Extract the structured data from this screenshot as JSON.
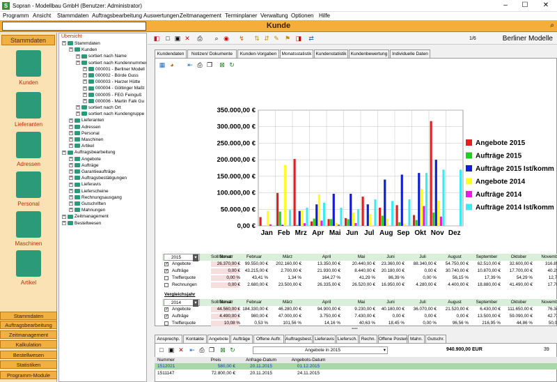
{
  "window": {
    "title": "Sopran - Modellbau GmbH (Benutzer: Administrator)",
    "app_icon": "S"
  },
  "menu": [
    "Programm",
    "Ansicht",
    "Stammdaten",
    "Auftragsbearbeitung",
    "Auswertungen",
    "Zeitmanagement",
    "Terminplaner",
    "Verwaltung",
    "Optionen",
    "Hilfe"
  ],
  "module_title": "Kunde",
  "left_nav": {
    "header": "Stammdaten",
    "items": [
      "Kunden",
      "Lieferanten",
      "Adressen",
      "Personal",
      "Maschinen",
      "Artikel"
    ],
    "modules": [
      "Stammdaten",
      "Auftragsbearbeitung",
      "Zeitmanagement",
      "Kalkulation",
      "Bestellwesen",
      "Statistiken",
      "Programm-Module"
    ]
  },
  "tree": {
    "header": "Übersicht",
    "rows": [
      {
        "text": "Stammdaten",
        "lvl": 0
      },
      {
        "text": "Kunden",
        "lvl": 1
      },
      {
        "text": "sortiert nach Name",
        "lvl": 2
      },
      {
        "text": "sortiert nach Kundennummer",
        "lvl": 2
      },
      {
        "text": "000001 - Berliner Modell",
        "lvl": 3
      },
      {
        "text": "000002 - Börde Guss",
        "lvl": 3
      },
      {
        "text": "000003 - Harzer Hütte",
        "lvl": 3
      },
      {
        "text": "000004 - Göltinger Maßt",
        "lvl": 3
      },
      {
        "text": "000005 - FEG Feinguß",
        "lvl": 3
      },
      {
        "text": "000006 - Martin Falk Gu",
        "lvl": 3
      },
      {
        "text": "sortiert nach Ort",
        "lvl": 2
      },
      {
        "text": "sortiert nach Kundengruppe",
        "lvl": 2
      },
      {
        "text": "Lieferanten",
        "lvl": 1
      },
      {
        "text": "Adressen",
        "lvl": 1
      },
      {
        "text": "Personal",
        "lvl": 1
      },
      {
        "text": "Maschinen",
        "lvl": 1
      },
      {
        "text": "Artikel",
        "lvl": 1
      },
      {
        "text": "Auftragsbearbeitung",
        "lvl": 0
      },
      {
        "text": "Angebote",
        "lvl": 1
      },
      {
        "text": "Aufträge",
        "lvl": 1
      },
      {
        "text": "Garantieaufträge",
        "lvl": 1
      },
      {
        "text": "Auftragsbestätigungen",
        "lvl": 1
      },
      {
        "text": "Lieferavis",
        "lvl": 1
      },
      {
        "text": "Lieferscheine",
        "lvl": 1
      },
      {
        "text": "Rechnungsausgang",
        "lvl": 1
      },
      {
        "text": "Gutschriften",
        "lvl": 1
      },
      {
        "text": "Mahnungen",
        "lvl": 1
      },
      {
        "text": "Zeitmanagement",
        "lvl": 0
      },
      {
        "text": "Bestellwesen",
        "lvl": 0
      }
    ]
  },
  "toolbar": {
    "record": "1/6",
    "customer_name": "Berliner Modelle"
  },
  "tabs_top": [
    "Kundendaten",
    "Notizen/ Dokumente",
    "Kunden-Vorgaben",
    "Monatsstatistik",
    "Kundenstatistik",
    "Kundenbewertung",
    "Individuelle Daten"
  ],
  "tabs_top_active": "Monatsstatistik",
  "colors": {
    "Angebote 2015": "#e02020",
    "Aufträge 2015": "#20d020",
    "Aufträge 2015 Ist/komm": "#1020d0",
    "Angebote 2014": "#ffff20",
    "Aufträge 2014": "#e020e0",
    "Aufträge 2014 Ist/komm": "#40e8f0"
  },
  "chart_data": {
    "type": "bar",
    "categories": [
      "Jan",
      "Feb",
      "Mrz",
      "Apr",
      "Mai",
      "Jun",
      "Jul",
      "Aug",
      "Sep",
      "Okt",
      "Nov",
      "Dez"
    ],
    "ylim": [
      0,
      350000
    ],
    "yticks": [
      "0,00 €",
      "50.000,00 €",
      "100.000,00 €",
      "150.000,00 €",
      "200.000,00 €",
      "250.000,00 €",
      "300.000,00 €",
      "350.000,00 €"
    ],
    "ytick_values": [
      0,
      50000,
      100000,
      150000,
      200000,
      250000,
      300000,
      350000
    ],
    "series": [
      {
        "name": "Angebote 2015",
        "values": [
          26370,
          99550,
          202160,
          13350,
          20440,
          23360,
          88340,
          54750,
          62510,
          32600,
          316890,
          0
        ]
      },
      {
        "name": "Aufträge 2015",
        "values": [
          0,
          43215,
          2700,
          21930,
          20440,
          20180,
          0,
          30740,
          10870,
          17700,
          40290,
          0
        ]
      },
      {
        "name": "Aufträge 2015 Ist/komm",
        "values": [
          0,
          3000,
          45000,
          65000,
          97000,
          97000,
          65000,
          140000,
          155000,
          160000,
          200000,
          0
        ]
      },
      {
        "name": "Angebote 2014",
        "values": [
          44560,
          184330,
          46280,
          94900,
          9230,
          40180,
          36070,
          21520,
          6430,
          111650,
          76340,
          0
        ]
      },
      {
        "name": "Aufträge 2014",
        "values": [
          4490,
          0,
          8000,
          16000,
          3750,
          8450,
          0,
          0,
          0,
          60000,
          28000,
          0
        ]
      },
      {
        "name": "Aufträge 2014 Ist/komm",
        "values": [
          0,
          48000,
          55000,
          70000,
          55000,
          50000,
          80000,
          75000,
          80000,
          160000,
          170000,
          170000
        ]
      }
    ]
  },
  "table": {
    "year1": "2015",
    "year2": "2014",
    "columns": [
      "Soll/Monat",
      "Januar",
      "Februar",
      "März",
      "April",
      "Mai",
      "Juni",
      "Juli",
      "August",
      "September",
      "Oktober",
      "Novembe"
    ],
    "rows2015": [
      {
        "label": "Angebote",
        "checked": true,
        "vals": [
          "",
          "26.370,00 €",
          "99.550,00 €",
          "202.160,00 €",
          "13.350,00 €",
          "20.440,00 €",
          "23.360,00 €",
          "88.340,00 €",
          "54.750,00 €",
          "62.510,00 €",
          "32.600,00 €",
          "316.890,0"
        ]
      },
      {
        "label": "Aufträge",
        "checked": true,
        "vals": [
          "",
          "0,00 €",
          "43.215,00 €",
          "2.700,00 €",
          "21.930,00 €",
          "8.440,00 €",
          "20.180,00 €",
          "0,00 €",
          "30.740,00 €",
          "10.870,00 €",
          "17.700,00 €",
          "40.290,0"
        ]
      },
      {
        "label": "Trefferquote",
        "checked": false,
        "vals": [
          "",
          "0,00 %",
          "43,41 %",
          "1,34 %",
          "164,27 %",
          "41,29 %",
          "86,39 %",
          "0,00 %",
          "56,15 %",
          "17,39 %",
          "54,29 %",
          "12,71 %"
        ]
      },
      {
        "label": "Rechnungen",
        "checked": false,
        "vals": [
          "",
          "0,00 €",
          "2.680,00 €",
          "23.500,00 €",
          "26.335,00 €",
          "26.520,00 €",
          "16.950,00 €",
          "4.280,00 €",
          "4.400,00 €",
          "18.880,00 €",
          "41.490,00 €",
          "17.700,0"
        ]
      }
    ],
    "compare_label": "Vergleichsjahr",
    "rows2014": [
      {
        "label": "Angebote",
        "checked": true,
        "vals": [
          "",
          "44.560,00 €",
          "184.330,00 €",
          "46.280,00 €",
          "94.900,00 €",
          "9.230,00 €",
          "40.180,00 €",
          "36.070,00 €",
          "21.520,00 €",
          "6.430,00 €",
          "111.650,00 €",
          "76.340,0"
        ]
      },
      {
        "label": "Aufträge",
        "checked": true,
        "vals": [
          "",
          "4.490,00 €",
          "980,00 €",
          "47.000,00 €",
          "3.750,00 €",
          "7.430,00 €",
          "0,00 €",
          "0,00 €",
          "0,00 €",
          "13.500,00 €",
          "59.090,00 €",
          "42.720,0"
        ]
      },
      {
        "label": "Trefferquote",
        "checked": false,
        "vals": [
          "",
          "10,08 %",
          "0,53 %",
          "101,56 %",
          "14,16 %",
          "40,63 %",
          "18,45 %",
          "0,00 %",
          "96,56 %",
          "216,95 %",
          "44,86 %",
          "50,00 %"
        ]
      }
    ]
  },
  "tabs_bottom": [
    "Ansprechp.",
    "Kontakte",
    "Angebote",
    "Aufträge",
    "Offene Auftr.",
    "Auftragsbest.",
    "Lieferavis",
    "Liefersch.",
    "Rechn.",
    "Offene Posten",
    "Mahn.",
    "Gutschr."
  ],
  "tabs_bottom_active": "Angebote",
  "bottom": {
    "dropdown": "Angebote in 2015",
    "total": "940.900,00 EUR",
    "count": "39",
    "columns": [
      "Nummer",
      "Preis",
      "Anfrage-Datum",
      "Angebots-Datum"
    ],
    "rows": [
      [
        "1512021",
        "580,00 €",
        "20.11.2015",
        "01.12.2015"
      ],
      [
        "1511147",
        "72.800,00 €",
        "20.11.2015",
        "24.11.2015"
      ]
    ]
  }
}
